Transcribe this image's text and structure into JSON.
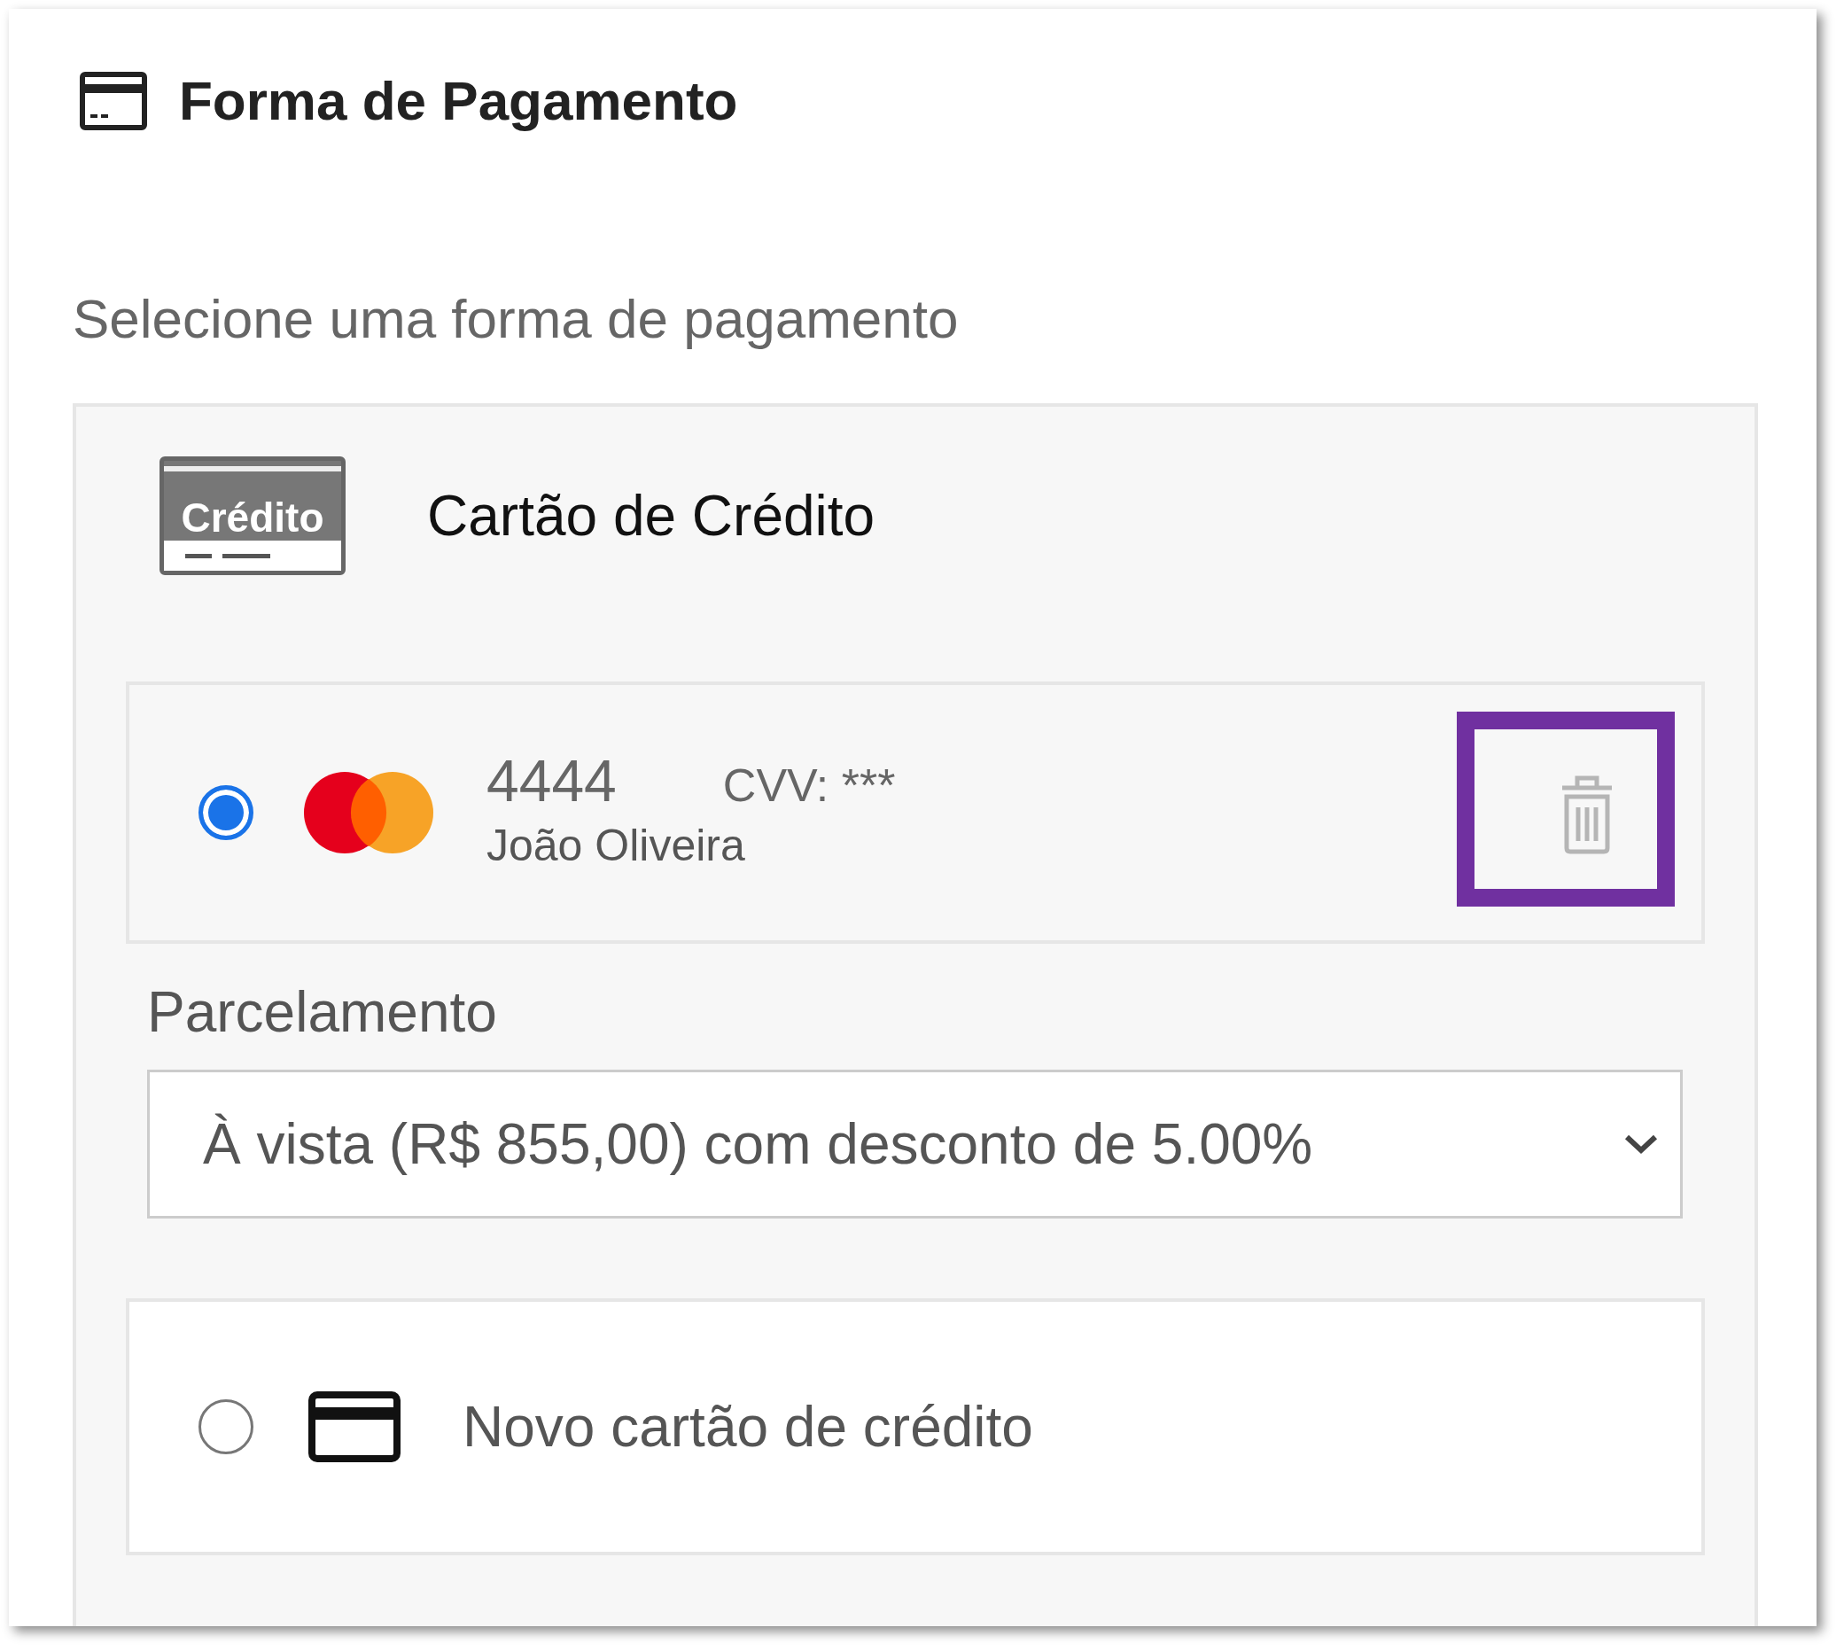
{
  "title": "Forma de Pagamento",
  "subtitle": "Selecione uma forma de pagamento",
  "method": {
    "icon_label": "Crédito",
    "label": "Cartão de Crédito"
  },
  "saved_card": {
    "selected": true,
    "number": "4444",
    "cvv": "CVV: ***",
    "holder": "João Oliveira",
    "delete_highlighted": true
  },
  "installments": {
    "label": "Parcelamento",
    "value": "À vista (R$ 855,00) com desconto de 5.00%"
  },
  "new_card": {
    "selected": false,
    "label": "Novo cartão de crédito"
  }
}
